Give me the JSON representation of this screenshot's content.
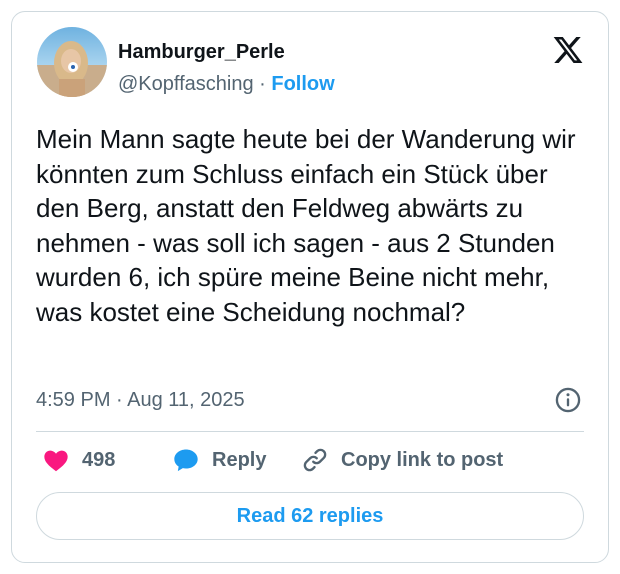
{
  "author": {
    "display_name": "Hamburger_Perle",
    "handle": "@Kopffasching",
    "separator": " · ",
    "follow_label": "Follow"
  },
  "tweet": {
    "text": "Mein Mann sagte heute bei der Wanderung wir könnten zum Schluss einfach ein Stück über den Berg, anstatt den Feldweg abwärts zu nehmen - was soll ich sagen - aus 2 Stunden wurden 6, ich spüre meine Beine nicht mehr, was kostet eine Scheidung nochmal?",
    "timestamp": "4:59 PM · Aug 11, 2025"
  },
  "actions": {
    "likes": "498",
    "reply_label": "Reply",
    "copy_link_label": "Copy link to post"
  },
  "footer": {
    "read_replies_label": "Read 62 replies"
  },
  "icons": {
    "like": "heart-icon",
    "reply": "speech-bubble-icon",
    "copy_link": "link-icon",
    "info": "info-icon",
    "brand": "x-logo-icon"
  },
  "colors": {
    "accent": "#1d9bf0",
    "like": "#f91880",
    "text": "#0f1419",
    "muted": "#536471",
    "border": "#cfd9de"
  }
}
